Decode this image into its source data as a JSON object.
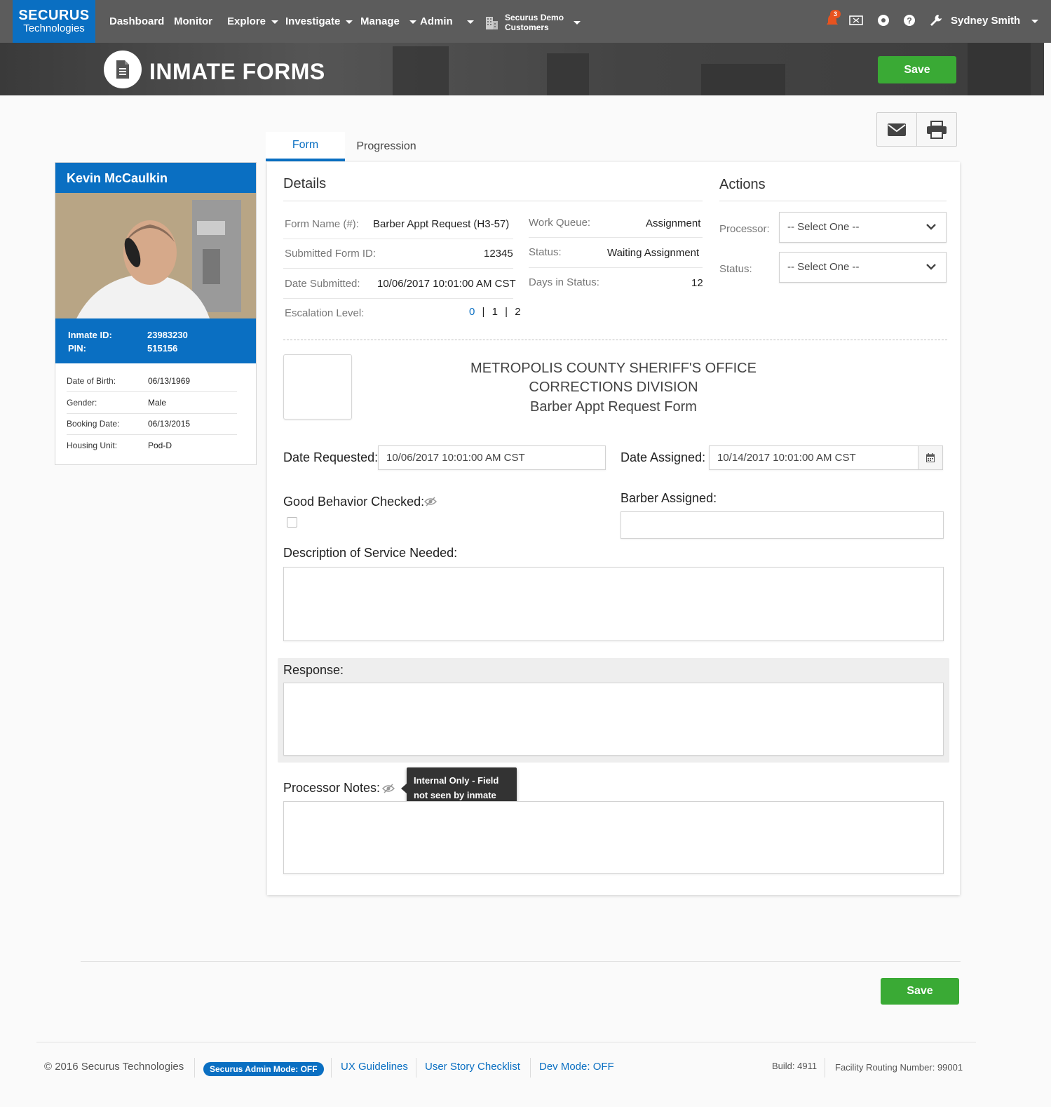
{
  "nav": {
    "logo_line1": "SECURUS",
    "logo_line2": "Technologies",
    "items": [
      "Dashboard",
      "Monitor",
      "Explore",
      "Investigate",
      "Manage",
      "Admin"
    ],
    "org_line1": "Securus Demo",
    "org_line2": "Customers",
    "notification_count": "3",
    "user_name": "Sydney Smith"
  },
  "header": {
    "title": "INMATE FORMS",
    "save_label": "Save"
  },
  "tabs": [
    "Form",
    "Progression"
  ],
  "inmate": {
    "name": "Kevin McCaulkin",
    "id_label": "Inmate ID:",
    "id_value": "23983230",
    "pin_label": "PIN:",
    "pin_value": "515156",
    "rows": [
      {
        "label": "Date of Birth:",
        "value": "06/13/1969"
      },
      {
        "label": "Gender:",
        "value": "Male"
      },
      {
        "label": "Booking Date:",
        "value": "06/13/2015"
      },
      {
        "label": "Housing Unit:",
        "value": "Pod-D"
      }
    ]
  },
  "details": {
    "heading": "Details",
    "form_name_label": "Form Name (#):",
    "form_name_value": "Barber Appt Request  (H3-57)",
    "submitted_id_label": "Submitted Form ID:",
    "submitted_id_value": "12345",
    "date_submitted_label": "Date Submitted:",
    "date_submitted_value": "10/06/2017 10:01:00 AM CST",
    "escalation_label": "Escalation Level:",
    "escalation_levels": [
      "0",
      "1",
      "2"
    ],
    "work_queue_label": "Work Queue:",
    "work_queue_value": "Assignment",
    "status_label": "Status:",
    "status_value": "Waiting Assignment",
    "days_label": "Days in Status:",
    "days_value": "12"
  },
  "actions": {
    "heading": "Actions",
    "processor_label": "Processor:",
    "processor_value": "-- Select One --",
    "status_label": "Status:",
    "status_value": "-- Select One --"
  },
  "form": {
    "header_line1": "METROPOLIS COUNTY SHERIFF'S OFFICE",
    "header_line2": "CORRECTIONS DIVISION",
    "header_line3": "Barber Appt Request Form",
    "date_requested_label": "Date Requested:",
    "date_requested_value": "10/06/2017 10:01:00 AM CST",
    "date_assigned_label": "Date Assigned:",
    "date_assigned_value": "10/14/2017 10:01:00 AM CST",
    "good_behavior_label": "Good Behavior Checked:",
    "barber_assigned_label": "Barber Assigned:",
    "barber_assigned_value": "",
    "description_label": "Description of Service Needed:",
    "description_value": "",
    "response_label": "Response:",
    "response_value": "",
    "processor_notes_label": "Processor Notes:",
    "processor_notes_value": "",
    "tooltip_line1": "Internal Only - Field",
    "tooltip_line2": "not seen by inmate"
  },
  "bottom": {
    "save_label": "Save"
  },
  "footer": {
    "copyright": "© 2016 Securus Technologies",
    "admin_mode": "Securus Admin Mode: OFF",
    "ux_guidelines": "UX Guidelines",
    "user_story": "User Story Checklist",
    "dev_mode": "Dev Mode: OFF",
    "build": "Build: 4911",
    "routing": "Facility Routing Number: 99001"
  }
}
